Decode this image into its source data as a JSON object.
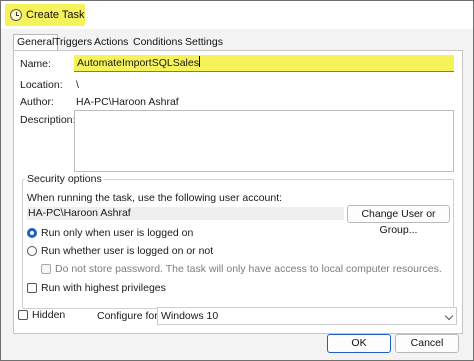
{
  "window": {
    "title": "Create Task"
  },
  "tabs": [
    "General",
    "Triggers",
    "Actions",
    "Conditions",
    "Settings"
  ],
  "general": {
    "name_label": "Name:",
    "name_value": "AutomateImportSQLSales",
    "location_label": "Location:",
    "location_value": "\\",
    "author_label": "Author:",
    "author_value": "HA-PC\\Haroon Ashraf",
    "description_label": "Description:",
    "description_value": ""
  },
  "security": {
    "title": "Security options",
    "prompt": "When running the task, use the following user account:",
    "account": "HA-PC\\Haroon Ashraf",
    "change_button": "Change User or Group...",
    "radio_logged_on": "Run only when user is logged on",
    "radio_logged_on_checked": true,
    "radio_whether": "Run whether user is logged on or not",
    "no_store_password": "Do not store password.  The task will only have access to local computer resources.",
    "highest_privileges": "Run with highest privileges"
  },
  "footer": {
    "hidden_label": "Hidden",
    "configure_label": "Configure for:",
    "configure_value": "Windows 10",
    "ok_label": "OK",
    "cancel_label": "Cancel"
  },
  "colors": {
    "highlight": "#f6f25a",
    "accent": "#1f5fbf",
    "primary_button_border": "#1f5fbf"
  }
}
